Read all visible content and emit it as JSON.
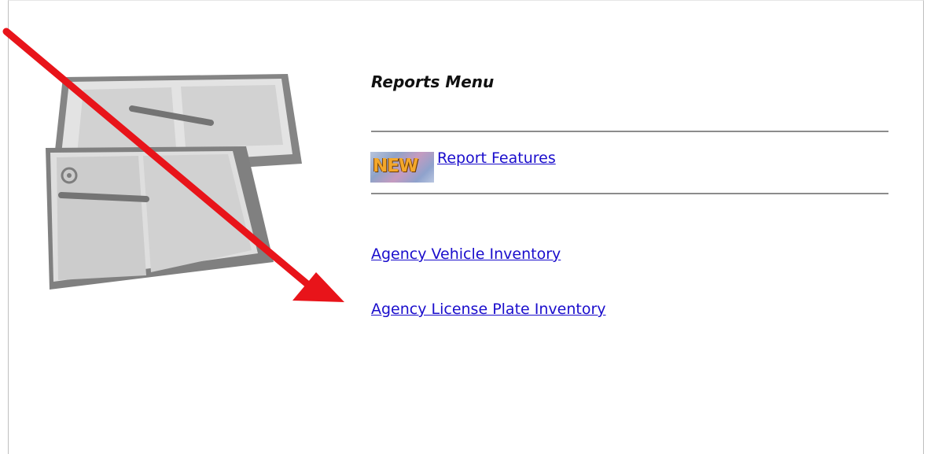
{
  "reports_menu": {
    "title": "Reports Menu",
    "new_badge": "NEW",
    "links": {
      "report_features": "Report Features",
      "vehicle_inventory": "Agency Vehicle Inventory",
      "license_plate_inventory": "Agency License Plate Inventory"
    }
  },
  "colors": {
    "link": "#1a0dcc",
    "annotation_arrow": "#e8141a",
    "badge_text": "#f3a72a"
  }
}
